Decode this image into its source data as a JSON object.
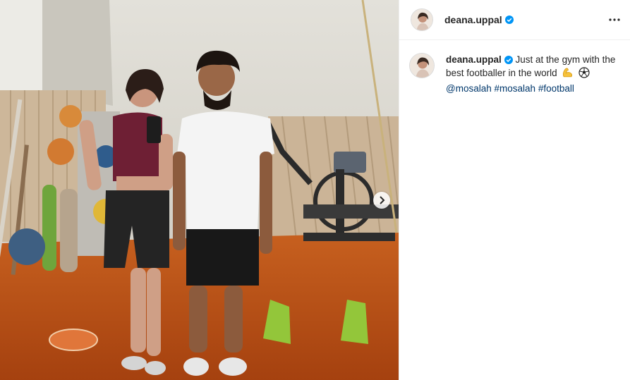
{
  "post": {
    "image_alt": "Two people standing in a gym, one holding a phone for a mirror selfie",
    "next_icon": "chevron-right-icon"
  },
  "header": {
    "username": "deana.uppal",
    "verified_icon": "verified-badge-icon",
    "more_icon": "more-options-icon"
  },
  "caption": {
    "username": "deana.uppal",
    "text": "Just at the gym with the best footballer in the world",
    "emojis": [
      "flexed-biceps-icon",
      "soccer-ball-icon"
    ],
    "mentions": [
      "@mosalah"
    ],
    "hashtags": [
      "#mosalah",
      "#football"
    ]
  },
  "colors": {
    "verified": "#0095f6",
    "link": "#00376b",
    "floor": "#b8501c",
    "divider": "#efefef"
  }
}
